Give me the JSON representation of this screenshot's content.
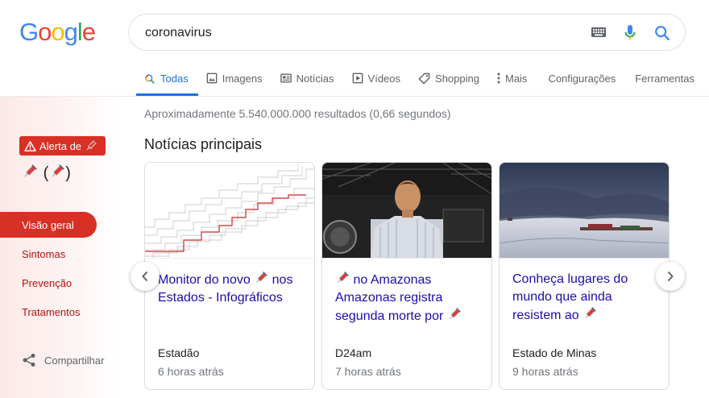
{
  "logo": {
    "text": "Google"
  },
  "search": {
    "query": "coronavirus"
  },
  "tabs": [
    {
      "label": "Todas",
      "icon": "search-icon"
    },
    {
      "label": "Imagens",
      "icon": "image-icon"
    },
    {
      "label": "Notícias",
      "icon": "news-icon"
    },
    {
      "label": "Vídeos",
      "icon": "play-icon"
    },
    {
      "label": "Shopping",
      "icon": "tag-icon"
    },
    {
      "label": "Mais",
      "icon": "more-vert-icon"
    },
    {
      "label": "Configurações"
    },
    {
      "label": "Ferramentas"
    }
  ],
  "stats": "Aproximadamente 5.540.000.000 resultados (0,66 segundos)",
  "sidebar": {
    "alert_label": "Alerta de",
    "nav": [
      "Visão geral",
      "Sintomas",
      "Prevenção",
      "Tratamentos"
    ],
    "share_label": "Compartilhar"
  },
  "news": {
    "title": "Notícias principais",
    "cards": [
      {
        "headline_a": "Monitor do novo",
        "headline_b": "nos Estados - Infográficos",
        "source": "Estadão",
        "age": "6 horas atrás"
      },
      {
        "headline_a": "",
        "headline_b": "no Amazonas Amazonas registra segunda morte por",
        "source": "D24am",
        "age": "7 horas atrás"
      },
      {
        "headline_a": "Conheça lugares do mundo que ainda resistem ao",
        "headline_b": "",
        "source": "Estado de Minas",
        "age": "9 horas atrás"
      }
    ]
  },
  "colors": {
    "accent": "#1a73e8",
    "alert": "#d93025",
    "link": "#1a0dab"
  }
}
